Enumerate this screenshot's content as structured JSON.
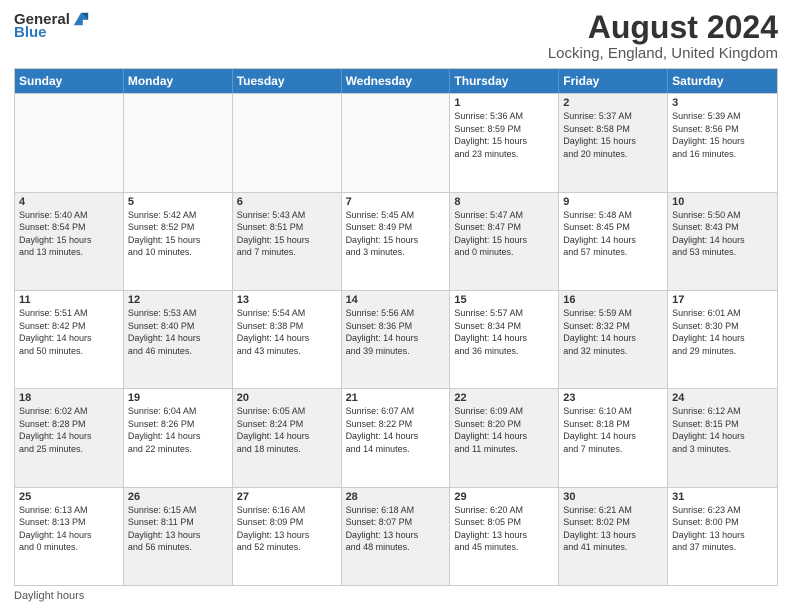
{
  "header": {
    "logo_general": "General",
    "logo_blue": "Blue",
    "month_year": "August 2024",
    "location": "Locking, England, United Kingdom"
  },
  "weekdays": [
    "Sunday",
    "Monday",
    "Tuesday",
    "Wednesday",
    "Thursday",
    "Friday",
    "Saturday"
  ],
  "footer": {
    "daylight_label": "Daylight hours"
  },
  "rows": [
    [
      {
        "day": "",
        "text": "",
        "shaded": false,
        "empty": true
      },
      {
        "day": "",
        "text": "",
        "shaded": false,
        "empty": true
      },
      {
        "day": "",
        "text": "",
        "shaded": false,
        "empty": true
      },
      {
        "day": "",
        "text": "",
        "shaded": false,
        "empty": true
      },
      {
        "day": "1",
        "text": "Sunrise: 5:36 AM\nSunset: 8:59 PM\nDaylight: 15 hours\nand 23 minutes.",
        "shaded": false,
        "empty": false
      },
      {
        "day": "2",
        "text": "Sunrise: 5:37 AM\nSunset: 8:58 PM\nDaylight: 15 hours\nand 20 minutes.",
        "shaded": true,
        "empty": false
      },
      {
        "day": "3",
        "text": "Sunrise: 5:39 AM\nSunset: 8:56 PM\nDaylight: 15 hours\nand 16 minutes.",
        "shaded": false,
        "empty": false
      }
    ],
    [
      {
        "day": "4",
        "text": "Sunrise: 5:40 AM\nSunset: 8:54 PM\nDaylight: 15 hours\nand 13 minutes.",
        "shaded": true,
        "empty": false
      },
      {
        "day": "5",
        "text": "Sunrise: 5:42 AM\nSunset: 8:52 PM\nDaylight: 15 hours\nand 10 minutes.",
        "shaded": false,
        "empty": false
      },
      {
        "day": "6",
        "text": "Sunrise: 5:43 AM\nSunset: 8:51 PM\nDaylight: 15 hours\nand 7 minutes.",
        "shaded": true,
        "empty": false
      },
      {
        "day": "7",
        "text": "Sunrise: 5:45 AM\nSunset: 8:49 PM\nDaylight: 15 hours\nand 3 minutes.",
        "shaded": false,
        "empty": false
      },
      {
        "day": "8",
        "text": "Sunrise: 5:47 AM\nSunset: 8:47 PM\nDaylight: 15 hours\nand 0 minutes.",
        "shaded": true,
        "empty": false
      },
      {
        "day": "9",
        "text": "Sunrise: 5:48 AM\nSunset: 8:45 PM\nDaylight: 14 hours\nand 57 minutes.",
        "shaded": false,
        "empty": false
      },
      {
        "day": "10",
        "text": "Sunrise: 5:50 AM\nSunset: 8:43 PM\nDaylight: 14 hours\nand 53 minutes.",
        "shaded": true,
        "empty": false
      }
    ],
    [
      {
        "day": "11",
        "text": "Sunrise: 5:51 AM\nSunset: 8:42 PM\nDaylight: 14 hours\nand 50 minutes.",
        "shaded": false,
        "empty": false
      },
      {
        "day": "12",
        "text": "Sunrise: 5:53 AM\nSunset: 8:40 PM\nDaylight: 14 hours\nand 46 minutes.",
        "shaded": true,
        "empty": false
      },
      {
        "day": "13",
        "text": "Sunrise: 5:54 AM\nSunset: 8:38 PM\nDaylight: 14 hours\nand 43 minutes.",
        "shaded": false,
        "empty": false
      },
      {
        "day": "14",
        "text": "Sunrise: 5:56 AM\nSunset: 8:36 PM\nDaylight: 14 hours\nand 39 minutes.",
        "shaded": true,
        "empty": false
      },
      {
        "day": "15",
        "text": "Sunrise: 5:57 AM\nSunset: 8:34 PM\nDaylight: 14 hours\nand 36 minutes.",
        "shaded": false,
        "empty": false
      },
      {
        "day": "16",
        "text": "Sunrise: 5:59 AM\nSunset: 8:32 PM\nDaylight: 14 hours\nand 32 minutes.",
        "shaded": true,
        "empty": false
      },
      {
        "day": "17",
        "text": "Sunrise: 6:01 AM\nSunset: 8:30 PM\nDaylight: 14 hours\nand 29 minutes.",
        "shaded": false,
        "empty": false
      }
    ],
    [
      {
        "day": "18",
        "text": "Sunrise: 6:02 AM\nSunset: 8:28 PM\nDaylight: 14 hours\nand 25 minutes.",
        "shaded": true,
        "empty": false
      },
      {
        "day": "19",
        "text": "Sunrise: 6:04 AM\nSunset: 8:26 PM\nDaylight: 14 hours\nand 22 minutes.",
        "shaded": false,
        "empty": false
      },
      {
        "day": "20",
        "text": "Sunrise: 6:05 AM\nSunset: 8:24 PM\nDaylight: 14 hours\nand 18 minutes.",
        "shaded": true,
        "empty": false
      },
      {
        "day": "21",
        "text": "Sunrise: 6:07 AM\nSunset: 8:22 PM\nDaylight: 14 hours\nand 14 minutes.",
        "shaded": false,
        "empty": false
      },
      {
        "day": "22",
        "text": "Sunrise: 6:09 AM\nSunset: 8:20 PM\nDaylight: 14 hours\nand 11 minutes.",
        "shaded": true,
        "empty": false
      },
      {
        "day": "23",
        "text": "Sunrise: 6:10 AM\nSunset: 8:18 PM\nDaylight: 14 hours\nand 7 minutes.",
        "shaded": false,
        "empty": false
      },
      {
        "day": "24",
        "text": "Sunrise: 6:12 AM\nSunset: 8:15 PM\nDaylight: 14 hours\nand 3 minutes.",
        "shaded": true,
        "empty": false
      }
    ],
    [
      {
        "day": "25",
        "text": "Sunrise: 6:13 AM\nSunset: 8:13 PM\nDaylight: 14 hours\nand 0 minutes.",
        "shaded": false,
        "empty": false
      },
      {
        "day": "26",
        "text": "Sunrise: 6:15 AM\nSunset: 8:11 PM\nDaylight: 13 hours\nand 56 minutes.",
        "shaded": true,
        "empty": false
      },
      {
        "day": "27",
        "text": "Sunrise: 6:16 AM\nSunset: 8:09 PM\nDaylight: 13 hours\nand 52 minutes.",
        "shaded": false,
        "empty": false
      },
      {
        "day": "28",
        "text": "Sunrise: 6:18 AM\nSunset: 8:07 PM\nDaylight: 13 hours\nand 48 minutes.",
        "shaded": true,
        "empty": false
      },
      {
        "day": "29",
        "text": "Sunrise: 6:20 AM\nSunset: 8:05 PM\nDaylight: 13 hours\nand 45 minutes.",
        "shaded": false,
        "empty": false
      },
      {
        "day": "30",
        "text": "Sunrise: 6:21 AM\nSunset: 8:02 PM\nDaylight: 13 hours\nand 41 minutes.",
        "shaded": true,
        "empty": false
      },
      {
        "day": "31",
        "text": "Sunrise: 6:23 AM\nSunset: 8:00 PM\nDaylight: 13 hours\nand 37 minutes.",
        "shaded": false,
        "empty": false
      }
    ]
  ]
}
